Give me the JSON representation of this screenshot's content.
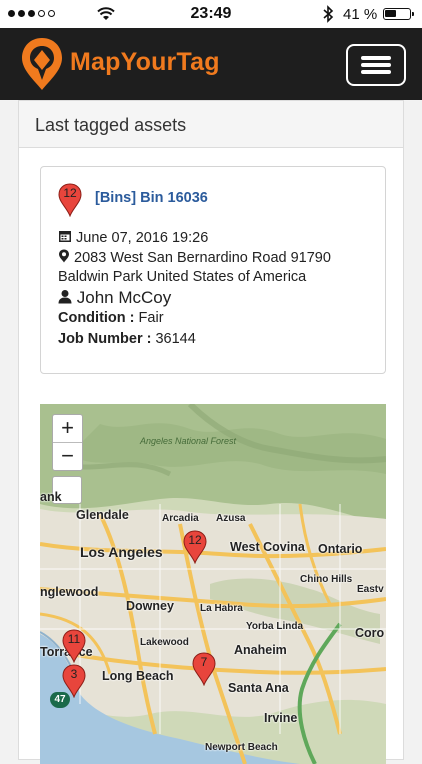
{
  "status_bar": {
    "time": "23:49",
    "battery": "41 %",
    "signal_dots_filled": 3,
    "signal_dots_total": 5,
    "battery_level": 0.41
  },
  "header": {
    "brand": "MapYourTag",
    "brand_color": "#f07a1e",
    "logo_icon": "pin-logo-icon",
    "menu_icon": "hamburger-icon"
  },
  "panel": {
    "heading": "Last tagged assets"
  },
  "asset": {
    "marker_number": "12",
    "category": "[Bins]",
    "name": "Bin 16036",
    "date": "June 07, 2016 19:26",
    "address_line1": "2083 West San Bernardino Road 91790",
    "address_line2": "Baldwin Park United States of America",
    "user": "John McCoy",
    "condition_label": "Condition :",
    "condition_value": "Fair",
    "job_label": "Job Number :",
    "job_value": "36144"
  },
  "map": {
    "zoom_in": "+",
    "zoom_out": "−",
    "forest_label": "Angeles National Forest",
    "cities": {
      "burbank": "ank",
      "glendale": "Glendale",
      "arcadia": "Arcadia",
      "azusa": "Azusa",
      "los_angeles": "Los Angeles",
      "west_covina": "West Covina",
      "ontario": "Ontario",
      "chino_hills": "Chino Hills",
      "inglewood": "nglewood",
      "downey": "Downey",
      "la_habra": "La Habra",
      "eastvale": "Eastv",
      "yorba_linda": "Yorba Linda",
      "torrance": "Torrance",
      "lakewood": "Lakewood",
      "anaheim": "Anaheim",
      "corona": "Coro",
      "long_beach": "Long Beach",
      "santa_ana": "Santa Ana",
      "irvine": "Irvine",
      "newport_beach": "Newport Beach"
    },
    "markers": [
      "12",
      "11",
      "3",
      "7"
    ],
    "highway_shield": "47",
    "marker_color": "#e8453c"
  }
}
